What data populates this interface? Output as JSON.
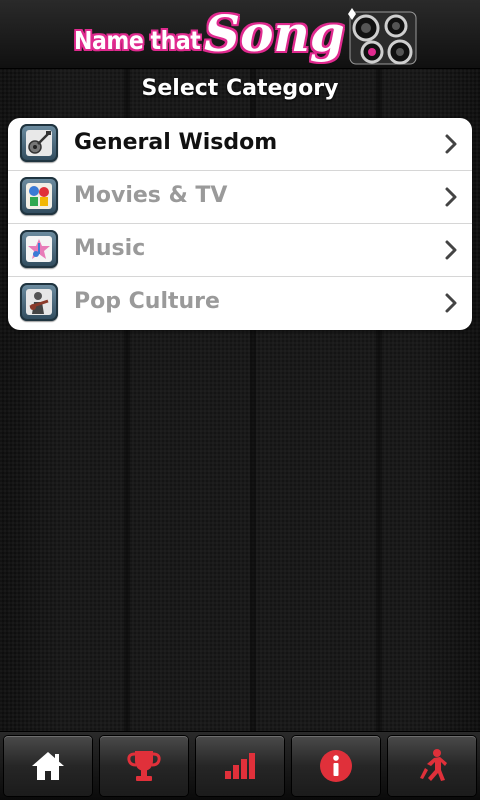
{
  "app": {
    "logo_name_text": "Name that",
    "logo_song_text": "Song",
    "brand_color": "#e02a8f"
  },
  "screen": {
    "title": "Select Category"
  },
  "categories": [
    {
      "label": "General Wisdom",
      "icon": "guitar-icon",
      "active": true
    },
    {
      "label": "Movies & TV",
      "icon": "movies-icon",
      "active": false
    },
    {
      "label": "Music",
      "icon": "music-icon",
      "active": false
    },
    {
      "label": "Pop Culture",
      "icon": "pop-culture-icon",
      "active": false
    }
  ],
  "tabbar": {
    "tabs": [
      {
        "icon": "home-icon",
        "color": "#ffffff"
      },
      {
        "icon": "trophy-icon",
        "color": "#e0303a"
      },
      {
        "icon": "stats-icon",
        "color": "#e0303a"
      },
      {
        "icon": "info-icon",
        "color": "#e0303a"
      },
      {
        "icon": "exit-runner-icon",
        "color": "#e0303a"
      }
    ]
  },
  "colors": {
    "accent_red": "#e0303a",
    "active_text": "#111111",
    "inactive_text": "#9a9a9a"
  }
}
